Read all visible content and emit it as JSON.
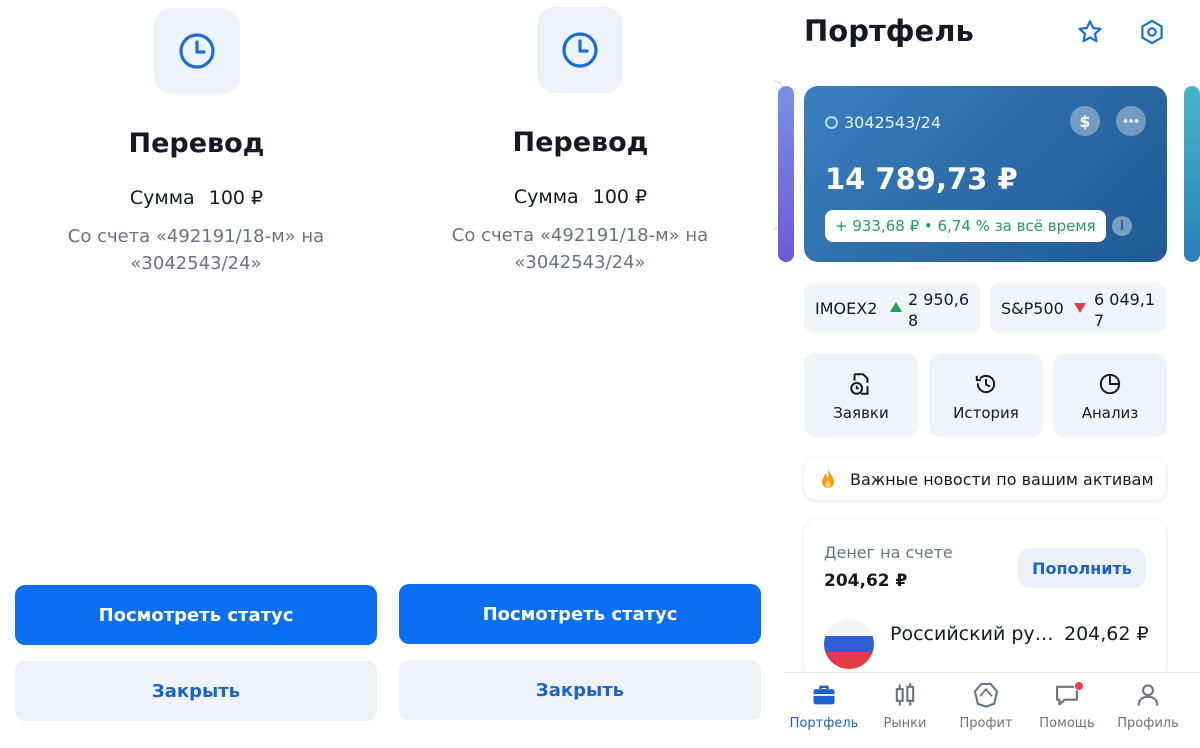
{
  "transfer_screens": [
    {
      "title": "Перевод",
      "sum_label": "Сумма",
      "sum_value": "100 ₽",
      "description": "Со счета «492191/18-м» на «3042543/24»",
      "primary_button": "Посмотреть статус",
      "secondary_button": "Закрыть",
      "icon": "clock-icon"
    },
    {
      "title": "Перевод",
      "sum_label": "Сумма",
      "sum_value": "100 ₽",
      "description": "Со счета «492191/18-м» на «3042543/24»",
      "primary_button": "Посмотреть статус",
      "secondary_button": "Закрыть",
      "icon": "clock-icon"
    }
  ],
  "portfolio": {
    "title": "Портфель",
    "header_icons": [
      "star-icon",
      "settings-icon"
    ],
    "account": {
      "number": "3042543/24",
      "balance": "14 789,73 ₽",
      "profit": "+ 933,68 ₽ • 6,74 % за всё время",
      "buttons": [
        "dollar-icon",
        "more-icon"
      ]
    },
    "indices": [
      {
        "name": "IMOEX2",
        "value": "2 950,68",
        "direction": "up",
        "color": "#1f9e5b"
      },
      {
        "name": "S&P500",
        "value": "6 049,17",
        "direction": "down",
        "color": "#e53948"
      }
    ],
    "quick_actions": [
      {
        "label": "Заявки",
        "icon": "orders-icon"
      },
      {
        "label": "История",
        "icon": "history-icon"
      },
      {
        "label": "Анализ",
        "icon": "pie-chart-icon"
      }
    ],
    "news": {
      "text": "Важные новости по вашим активам",
      "icon": "fire-icon"
    },
    "money": {
      "label": "Денег на счете",
      "amount": "204,62 ₽",
      "topup_button": "Пополнить",
      "currency_name": "Российский ру…",
      "currency_amount": "204,62 ₽"
    },
    "tabs": [
      {
        "label": "Портфель",
        "icon": "briefcase-icon",
        "active": true
      },
      {
        "label": "Рынки",
        "icon": "candles-icon",
        "active": false
      },
      {
        "label": "Профит",
        "icon": "profit-icon",
        "active": false
      },
      {
        "label": "Помощь",
        "icon": "chat-icon",
        "active": false,
        "badge": true
      },
      {
        "label": "Профиль",
        "icon": "user-icon",
        "active": false
      }
    ]
  },
  "colors": {
    "primary": "#0a6ff0",
    "accent_text": "#1d62c6",
    "card": "#2b6aa6",
    "up": "#1f9e5b",
    "down": "#e53948"
  }
}
